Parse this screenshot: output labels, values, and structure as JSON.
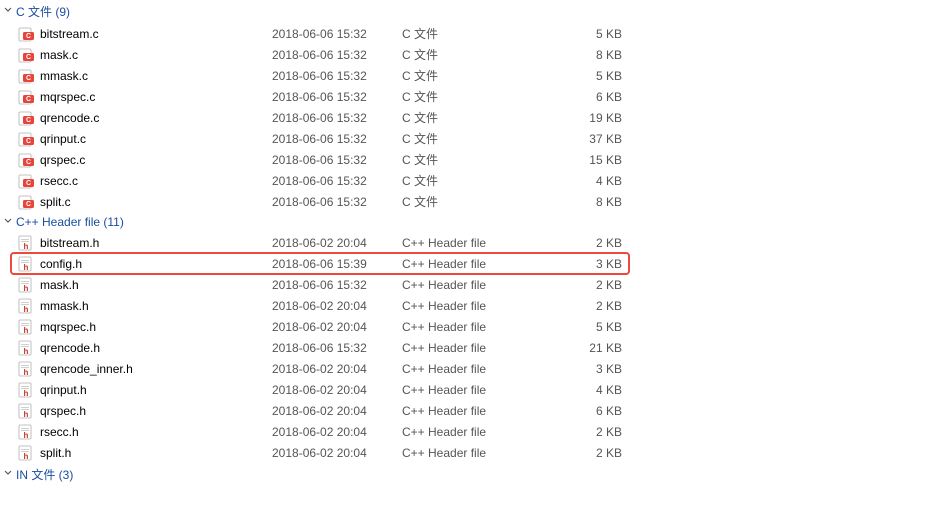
{
  "groups": [
    {
      "label": "C 文件 (9)",
      "icon": "c",
      "files": [
        {
          "name": "bitstream.c",
          "date": "2018-06-06 15:32",
          "type": "C 文件",
          "size": "5 KB"
        },
        {
          "name": "mask.c",
          "date": "2018-06-06 15:32",
          "type": "C 文件",
          "size": "8 KB"
        },
        {
          "name": "mmask.c",
          "date": "2018-06-06 15:32",
          "type": "C 文件",
          "size": "5 KB"
        },
        {
          "name": "mqrspec.c",
          "date": "2018-06-06 15:32",
          "type": "C 文件",
          "size": "6 KB"
        },
        {
          "name": "qrencode.c",
          "date": "2018-06-06 15:32",
          "type": "C 文件",
          "size": "19 KB"
        },
        {
          "name": "qrinput.c",
          "date": "2018-06-06 15:32",
          "type": "C 文件",
          "size": "37 KB"
        },
        {
          "name": "qrspec.c",
          "date": "2018-06-06 15:32",
          "type": "C 文件",
          "size": "15 KB"
        },
        {
          "name": "rsecc.c",
          "date": "2018-06-06 15:32",
          "type": "C 文件",
          "size": "4 KB"
        },
        {
          "name": "split.c",
          "date": "2018-06-06 15:32",
          "type": "C 文件",
          "size": "8 KB"
        }
      ]
    },
    {
      "label": "C++ Header file (11)",
      "icon": "h",
      "files": [
        {
          "name": "bitstream.h",
          "date": "2018-06-02 20:04",
          "type": "C++ Header file",
          "size": "2 KB"
        },
        {
          "name": "config.h",
          "date": "2018-06-06 15:39",
          "type": "C++ Header file",
          "size": "3 KB",
          "highlight": true
        },
        {
          "name": "mask.h",
          "date": "2018-06-06 15:32",
          "type": "C++ Header file",
          "size": "2 KB"
        },
        {
          "name": "mmask.h",
          "date": "2018-06-02 20:04",
          "type": "C++ Header file",
          "size": "2 KB"
        },
        {
          "name": "mqrspec.h",
          "date": "2018-06-02 20:04",
          "type": "C++ Header file",
          "size": "5 KB"
        },
        {
          "name": "qrencode.h",
          "date": "2018-06-06 15:32",
          "type": "C++ Header file",
          "size": "21 KB"
        },
        {
          "name": "qrencode_inner.h",
          "date": "2018-06-02 20:04",
          "type": "C++ Header file",
          "size": "3 KB"
        },
        {
          "name": "qrinput.h",
          "date": "2018-06-02 20:04",
          "type": "C++ Header file",
          "size": "4 KB"
        },
        {
          "name": "qrspec.h",
          "date": "2018-06-02 20:04",
          "type": "C++ Header file",
          "size": "6 KB"
        },
        {
          "name": "rsecc.h",
          "date": "2018-06-02 20:04",
          "type": "C++ Header file",
          "size": "2 KB"
        },
        {
          "name": "split.h",
          "date": "2018-06-02 20:04",
          "type": "C++ Header file",
          "size": "2 KB"
        }
      ]
    },
    {
      "label": "IN 文件 (3)",
      "icon": "in",
      "files": []
    }
  ]
}
